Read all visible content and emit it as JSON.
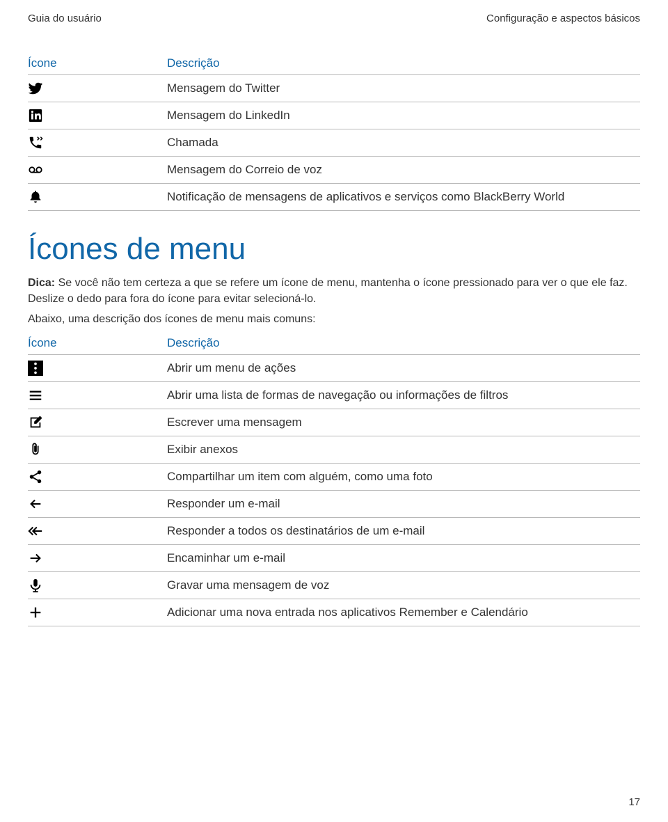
{
  "header": {
    "left": "Guia do usuário",
    "right": "Configuração e aspectos básicos"
  },
  "table1": {
    "head_icon": "Ícone",
    "head_desc": "Descrição",
    "rows": [
      {
        "icon": "twitter",
        "desc": "Mensagem do Twitter"
      },
      {
        "icon": "linkedin",
        "desc": "Mensagem do LinkedIn"
      },
      {
        "icon": "call",
        "desc": "Chamada"
      },
      {
        "icon": "voicemail",
        "desc": "Mensagem do Correio de voz"
      },
      {
        "icon": "bell",
        "desc": "Notificação de mensagens de aplicativos e serviços como BlackBerry World"
      }
    ]
  },
  "section_title": "Ícones de menu",
  "tip_label": "Dica:",
  "tip_text": " Se você não tem certeza a que se refere um ícone de menu, mantenha o ícone pressionado para ver o que ele faz. Deslize o dedo para fora do ícone para evitar selecioná-lo.",
  "intro2": "Abaixo, uma descrição dos ícones de menu mais comuns:",
  "table2": {
    "head_icon": "Ícone",
    "head_desc": "Descrição",
    "rows": [
      {
        "icon": "dots",
        "desc": "Abrir um menu de ações"
      },
      {
        "icon": "hamburger",
        "desc": "Abrir uma lista de formas de navegação ou informações de filtros"
      },
      {
        "icon": "compose",
        "desc": "Escrever uma mensagem"
      },
      {
        "icon": "attach",
        "desc": "Exibir anexos"
      },
      {
        "icon": "share",
        "desc": "Compartilhar um item com alguém, como uma foto"
      },
      {
        "icon": "reply",
        "desc": "Responder um e-mail"
      },
      {
        "icon": "replyall",
        "desc": "Responder a todos os destinatários de um e-mail"
      },
      {
        "icon": "forward",
        "desc": "Encaminhar um e-mail"
      },
      {
        "icon": "mic",
        "desc": "Gravar uma mensagem de voz"
      },
      {
        "icon": "plus",
        "desc": "Adicionar uma nova entrada nos aplicativos Remember e Calendário"
      }
    ]
  },
  "page_number": "17"
}
